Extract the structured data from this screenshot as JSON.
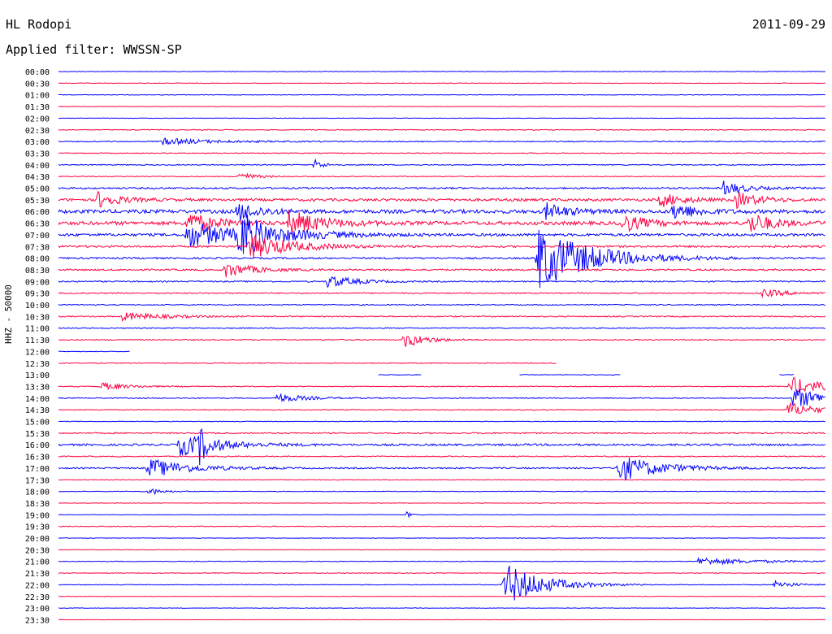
{
  "header": {
    "station": "HL Rodopi",
    "date": "2011-09-29",
    "filter": "Applied filter: WWSSN-SP"
  },
  "chart_data": {
    "type": "line",
    "title": "HL Rodopi",
    "date": "2011-09-29",
    "subtitle": "Applied filter: WWSSN-SP",
    "ylabel": "HHZ - 50000",
    "xlabel": "",
    "row_labels": [
      "00:00",
      "00:30",
      "01:00",
      "01:30",
      "02:00",
      "02:30",
      "03:00",
      "03:30",
      "04:00",
      "04:30",
      "05:00",
      "05:30",
      "06:00",
      "06:30",
      "07:00",
      "07:30",
      "08:00",
      "08:30",
      "09:00",
      "09:30",
      "10:00",
      "10:30",
      "11:00",
      "11:30",
      "12:00",
      "12:30",
      "13:00",
      "13:30",
      "14:00",
      "14:30",
      "15:00",
      "15:30",
      "16:00",
      "16:30",
      "17:00",
      "17:30",
      "18:00",
      "18:30",
      "19:00",
      "19:30",
      "20:00",
      "20:30",
      "21:00",
      "21:30",
      "22:00",
      "22:30",
      "23:00",
      "23:30"
    ],
    "series_colors": [
      "#0000ff",
      "#ff0040"
    ],
    "noise_level": [
      0.4,
      0.3,
      0.3,
      0.3,
      0.3,
      0.5,
      0.6,
      0.5,
      0.6,
      0.5,
      1.0,
      1.6,
      2.2,
      2.2,
      1.6,
      1.2,
      1.0,
      1.0,
      0.8,
      0.7,
      0.6,
      0.7,
      0.6,
      0.6,
      0.4,
      0.5,
      0.4,
      0.5,
      0.6,
      0.5,
      0.4,
      0.8,
      1.2,
      0.6,
      0.9,
      0.4,
      0.4,
      0.3,
      0.3,
      0.5,
      0.3,
      0.3,
      0.4,
      0.4,
      0.4,
      0.3,
      0.3,
      0.2
    ],
    "events": [
      {
        "row": 6,
        "minute": 4,
        "amp": 4,
        "dur": 2
      },
      {
        "row": 8,
        "minute": 10,
        "amp": 8,
        "dur": 0.3
      },
      {
        "row": 9,
        "minute": 7,
        "amp": 6,
        "dur": 0.6
      },
      {
        "row": 10,
        "minute": 26,
        "amp": 9,
        "dur": 0.8
      },
      {
        "row": 11,
        "minute": 1.5,
        "amp": 10,
        "dur": 0.8
      },
      {
        "row": 11,
        "minute": 23.5,
        "amp": 9,
        "dur": 0.8
      },
      {
        "row": 11,
        "minute": 26.5,
        "amp": 10,
        "dur": 0.8
      },
      {
        "row": 12,
        "minute": 7,
        "amp": 12,
        "dur": 0.8
      },
      {
        "row": 12,
        "minute": 19,
        "amp": 11,
        "dur": 0.8
      },
      {
        "row": 12,
        "minute": 24,
        "amp": 12,
        "dur": 0.8
      },
      {
        "row": 13,
        "minute": 5,
        "amp": 14,
        "dur": 1
      },
      {
        "row": 13,
        "minute": 9,
        "amp": 16,
        "dur": 1.2
      },
      {
        "row": 13,
        "minute": 22,
        "amp": 12,
        "dur": 0.8
      },
      {
        "row": 13,
        "minute": 27,
        "amp": 14,
        "dur": 0.8
      },
      {
        "row": 14,
        "minute": 5,
        "amp": 16,
        "dur": 2
      },
      {
        "row": 14,
        "minute": 7,
        "amp": 12,
        "dur": 2
      },
      {
        "row": 14,
        "minute": 7.2,
        "amp": 28,
        "dur": 0.3
      },
      {
        "row": 15,
        "minute": 7.4,
        "amp": 16,
        "dur": 1.6
      },
      {
        "row": 16,
        "minute": 18.7,
        "amp": 40,
        "dur": 2
      },
      {
        "row": 17,
        "minute": 6.5,
        "amp": 10,
        "dur": 1
      },
      {
        "row": 18,
        "minute": 10.5,
        "amp": 8,
        "dur": 1
      },
      {
        "row": 19,
        "minute": 27.5,
        "amp": 5,
        "dur": 1
      },
      {
        "row": 21,
        "minute": 2.5,
        "amp": 5,
        "dur": 1.5
      },
      {
        "row": 23,
        "minute": 13.5,
        "amp": 10,
        "dur": 0.8
      },
      {
        "row": 27,
        "minute": 1.6,
        "amp": 5,
        "dur": 1
      },
      {
        "row": 27,
        "minute": 28.6,
        "amp": 12,
        "dur": 1.2
      },
      {
        "row": 28,
        "minute": 8.5,
        "amp": 6,
        "dur": 1
      },
      {
        "row": 28,
        "minute": 28.7,
        "amp": 14,
        "dur": 1.2
      },
      {
        "row": 29,
        "minute": 28.5,
        "amp": 10,
        "dur": 1
      },
      {
        "row": 32,
        "minute": 4.7,
        "amp": 14,
        "dur": 1.5
      },
      {
        "row": 32,
        "minute": 5.5,
        "amp": 18,
        "dur": 0.3
      },
      {
        "row": 34,
        "minute": 3.5,
        "amp": 12,
        "dur": 1.5
      },
      {
        "row": 34,
        "minute": 21.8,
        "amp": 18,
        "dur": 1.5
      },
      {
        "row": 36,
        "minute": 3.5,
        "amp": 5,
        "dur": 0.5
      },
      {
        "row": 38,
        "minute": 13.6,
        "amp": 4,
        "dur": 0.2
      },
      {
        "row": 42,
        "minute": 25,
        "amp": 5,
        "dur": 2
      },
      {
        "row": 44,
        "minute": 17.4,
        "amp": 28,
        "dur": 1.4
      },
      {
        "row": 44,
        "minute": 28,
        "amp": 6,
        "dur": 0.6
      }
    ],
    "gaps": [
      {
        "row": 24,
        "from": 2.8,
        "to": 30
      },
      {
        "row": 25,
        "from": 19.5,
        "to": 30
      },
      {
        "row": 26,
        "from": 0,
        "to": 12.5
      },
      {
        "row": 26,
        "from": 14.2,
        "to": 18
      },
      {
        "row": 26,
        "from": 22,
        "to": 28.2
      },
      {
        "row": 26,
        "from": 28.8,
        "to": 30
      }
    ]
  }
}
